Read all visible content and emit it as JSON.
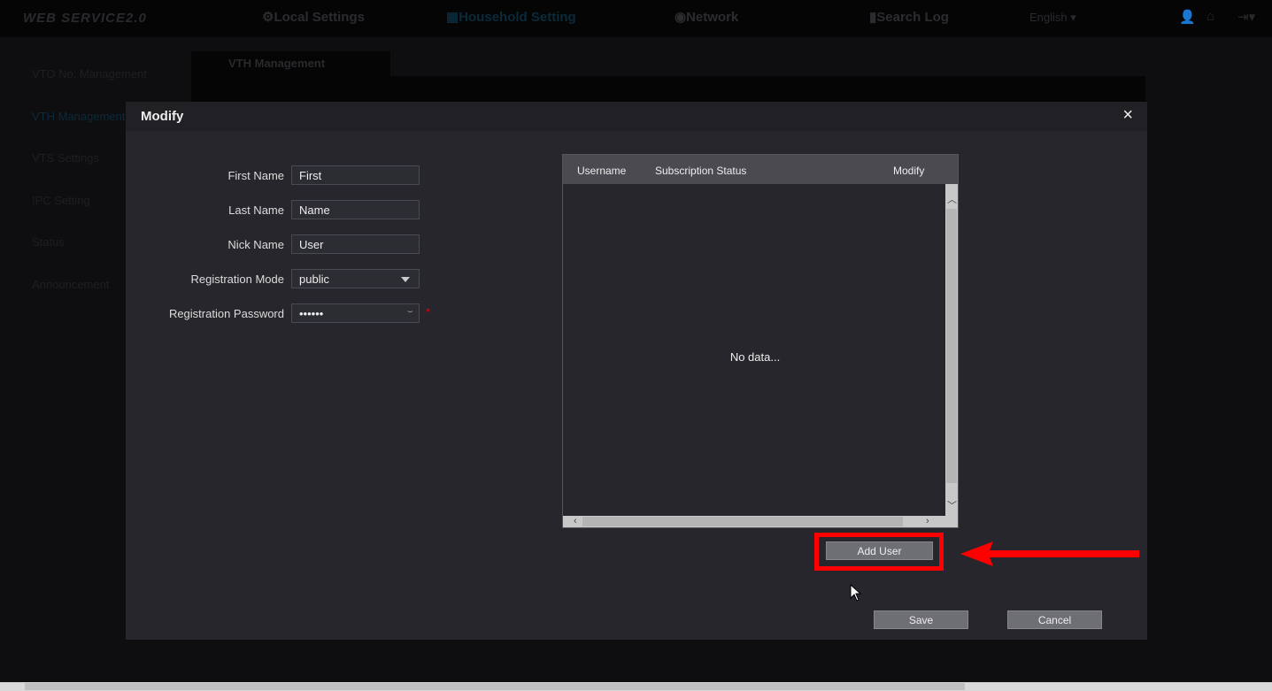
{
  "topbar": {
    "logo": "WEB SERVICE2.0",
    "nav": [
      {
        "label": "Local Settings",
        "icon": "gear-icon"
      },
      {
        "label": "Household Setting",
        "icon": "building-icon",
        "active": true
      },
      {
        "label": "Network",
        "icon": "globe-icon"
      },
      {
        "label": "Search Log",
        "icon": "log-icon"
      }
    ],
    "language": "English",
    "icons": [
      "user-icon",
      "home-icon",
      "logout-icon"
    ]
  },
  "sidebar": {
    "items": [
      {
        "label": "VTO No. Management"
      },
      {
        "label": "VTH Management",
        "active": true
      },
      {
        "label": "VTS Settings"
      },
      {
        "label": "IPC Setting"
      },
      {
        "label": "Status"
      },
      {
        "label": "Announcement"
      }
    ]
  },
  "background": {
    "tab": "VTH Management"
  },
  "dialog": {
    "title": "Modify",
    "close": "×",
    "form": {
      "first_name": {
        "label": "First Name",
        "value": "First"
      },
      "last_name": {
        "label": "Last Name",
        "value": "Name"
      },
      "nick_name": {
        "label": "Nick Name",
        "value": "User"
      },
      "registration_mode": {
        "label": "Registration Mode",
        "value": "public"
      },
      "registration_password": {
        "label": "Registration Password",
        "value": "••••••",
        "required": "*"
      }
    },
    "table": {
      "columns": [
        "Username",
        "Subscription Status",
        "Modify"
      ],
      "empty": "No data..."
    },
    "add_user": "Add User",
    "save": "Save",
    "cancel": "Cancel"
  },
  "colors": {
    "highlight": "#ff0000",
    "accent": "#0c2a3a"
  }
}
